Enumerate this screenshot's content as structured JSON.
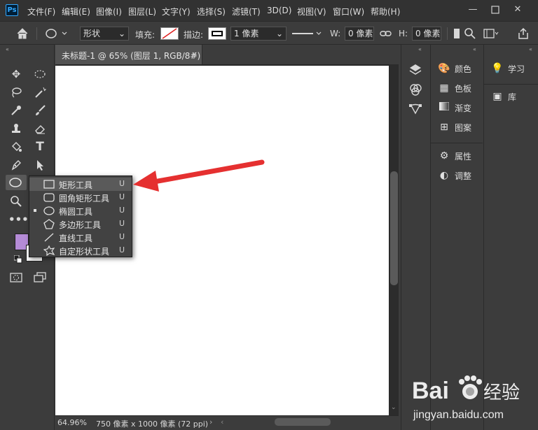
{
  "app": {
    "logo": "Ps"
  },
  "menu": [
    "文件(F)",
    "编辑(E)",
    "图像(I)",
    "图层(L)",
    "文字(Y)",
    "选择(S)",
    "滤镜(T)",
    "3D(D)",
    "视图(V)",
    "窗口(W)",
    "帮助(H)"
  ],
  "options": {
    "shape_mode": "形状",
    "fill_label": "填充:",
    "stroke_label": "描边:",
    "stroke_width": "1 像素",
    "w_label": "W:",
    "w_value": "0 像素",
    "h_label": "H:",
    "h_value": "0 像素"
  },
  "document": {
    "tab_title": "未标题-1 @ 65% (图层 1, RGB/8#)",
    "close": "×"
  },
  "status": {
    "zoom": "64.96%",
    "size": "750 像素 x 1000 像素 (72 ppi)"
  },
  "flyout": {
    "items": [
      {
        "label": "矩形工具",
        "key": "U",
        "selected": true,
        "active": false,
        "icon": "rectangle-icon"
      },
      {
        "label": "圆角矩形工具",
        "key": "U",
        "selected": false,
        "active": false,
        "icon": "rounded-rectangle-icon"
      },
      {
        "label": "椭圆工具",
        "key": "U",
        "selected": false,
        "active": true,
        "icon": "ellipse-icon"
      },
      {
        "label": "多边形工具",
        "key": "U",
        "selected": false,
        "active": false,
        "icon": "polygon-icon"
      },
      {
        "label": "直线工具",
        "key": "U",
        "selected": false,
        "active": false,
        "icon": "line-icon"
      },
      {
        "label": "自定形状工具",
        "key": "U",
        "selected": false,
        "active": false,
        "icon": "custom-shape-icon"
      }
    ]
  },
  "panels": {
    "group1": [
      {
        "label": "颜色",
        "icon": "palette-icon"
      },
      {
        "label": "色板",
        "icon": "swatches-icon"
      },
      {
        "label": "渐变",
        "icon": "gradient-icon"
      },
      {
        "label": "图案",
        "icon": "pattern-icon"
      }
    ],
    "group2": [
      {
        "label": "属性",
        "icon": "properties-icon"
      },
      {
        "label": "调整",
        "icon": "adjustments-icon"
      }
    ],
    "group3": [
      {
        "label": "学习",
        "icon": "lightbulb-icon"
      },
      {
        "label": "库",
        "icon": "library-icon"
      }
    ]
  },
  "colors": {
    "foreground": "#b48bd6",
    "background": "#ffffff",
    "arrow": "#e53030"
  },
  "watermark": {
    "brand_left": "Bai",
    "brand_right": "经验",
    "url": "jingyan.baidu.com"
  }
}
